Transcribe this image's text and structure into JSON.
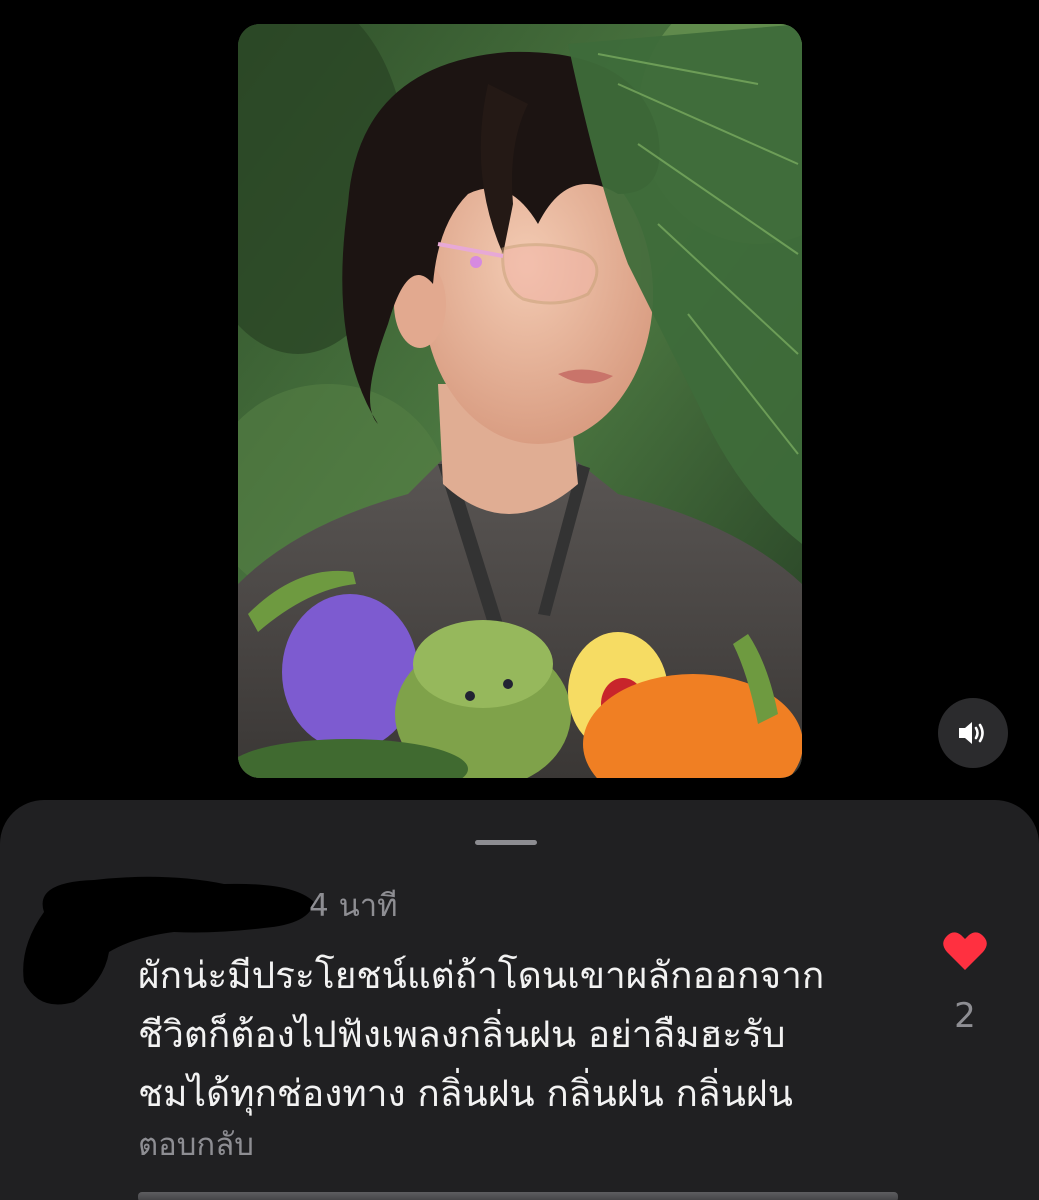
{
  "photo": {
    "alt": "photo",
    "palette": {
      "foliage": "#3e6b3a",
      "skin": "#e9b9a0",
      "hair": "#1c1412",
      "sweater": "#4d4a48",
      "eggplant": "#7d5bd0",
      "frog": "#7fa24a",
      "carrot": "#f07f23"
    }
  },
  "sound_button": {
    "icon": "speaker-icon"
  },
  "comment": {
    "time": "4 นาที",
    "lines": [
      "ผักน่ะมีประโยชน์แต่ถ้าโดนเขาผลักออกจาก",
      "ชีวิตก็ต้องไปฟังเพลงกลิ่นฝน อย่าลืมฮะรับ",
      "ชมได้ทุกช่องทาง กลิ่นฝน กลิ่นฝน กลิ่นฝน"
    ],
    "reply_label": "ตอบกลับ",
    "like_count": "2",
    "like_icon": "heart-icon",
    "like_color": "#ff3040"
  },
  "colors": {
    "background": "#000000",
    "sheet": "#202022",
    "secondary_text": "#8e8e93",
    "primary_text": "#f2f2f2"
  }
}
